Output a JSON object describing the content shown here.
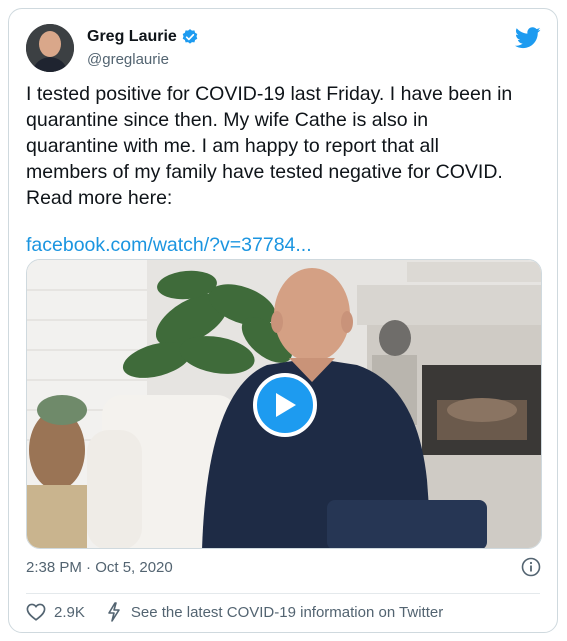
{
  "author": {
    "name": "Greg Laurie",
    "handle": "@greglaurie"
  },
  "tweet": {
    "text": "I tested positive for COVID-19 last Friday. I have been in\nquarantine since then. My wife Cathe is also in\nquarantine with me. I am happy to report that all\nmembers of my family have tested negative for COVID.\nRead more here:",
    "link": "facebook.com/watch/?v=37784..."
  },
  "meta": {
    "timestamp": "2:38 PM · Oct 5, 2020"
  },
  "footer": {
    "likes": "2.9K",
    "covid_notice": "See the latest COVID-19 information on Twitter"
  },
  "colors": {
    "accent": "#1d9bf0",
    "link": "#1b95e0",
    "muted": "#536471"
  },
  "icons": {
    "brand": "twitter-bird-icon",
    "verified": "verified-badge-icon",
    "play": "play-icon",
    "info": "info-icon",
    "like": "heart-icon",
    "covid": "lightning-icon"
  }
}
